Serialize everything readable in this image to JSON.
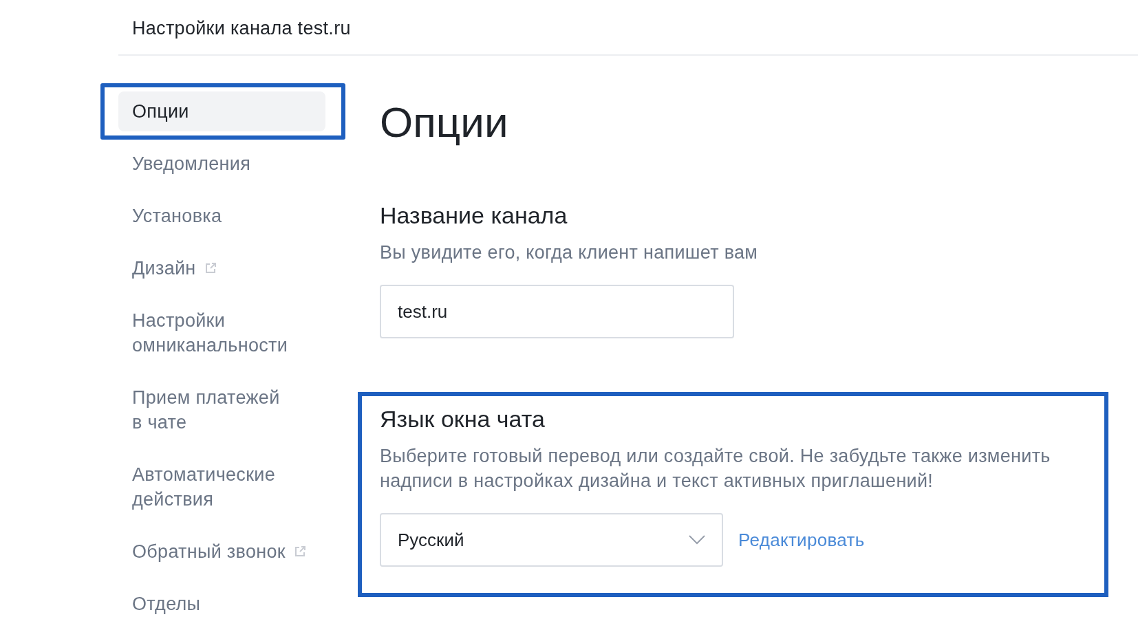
{
  "header": {
    "title": "Настройки канала test.ru"
  },
  "sidebar": {
    "items": [
      {
        "label": "Опции",
        "selected": true,
        "highlighted": true,
        "external": false
      },
      {
        "label": "Уведомления",
        "selected": false,
        "highlighted": false,
        "external": false
      },
      {
        "label": "Установка",
        "selected": false,
        "highlighted": false,
        "external": false
      },
      {
        "label": "Дизайн",
        "selected": false,
        "highlighted": false,
        "external": true
      },
      {
        "label": "Настройки омниканальности",
        "selected": false,
        "highlighted": false,
        "external": false
      },
      {
        "label": "Прием платежей в чате",
        "selected": false,
        "highlighted": false,
        "external": false
      },
      {
        "label": "Автоматические действия",
        "selected": false,
        "highlighted": false,
        "external": false
      },
      {
        "label": "Обратный звонок",
        "selected": false,
        "highlighted": false,
        "external": true
      },
      {
        "label": "Отделы",
        "selected": false,
        "highlighted": false,
        "external": false
      }
    ]
  },
  "page_title": "Опции",
  "sections": [
    {
      "kind": "input",
      "title": "Название канала",
      "description": "Вы увидите его, когда клиент напишет вам",
      "value": "test.ru",
      "highlighted": false
    },
    {
      "kind": "select",
      "title": "Язык окна чата",
      "description": "Выберите готовый перевод или создайте свой. Не забудьте также изменить надписи в настройках дизайна и текст активных приглашений!",
      "value": "Русский",
      "link": "Редактировать",
      "highlighted": true
    }
  ]
}
